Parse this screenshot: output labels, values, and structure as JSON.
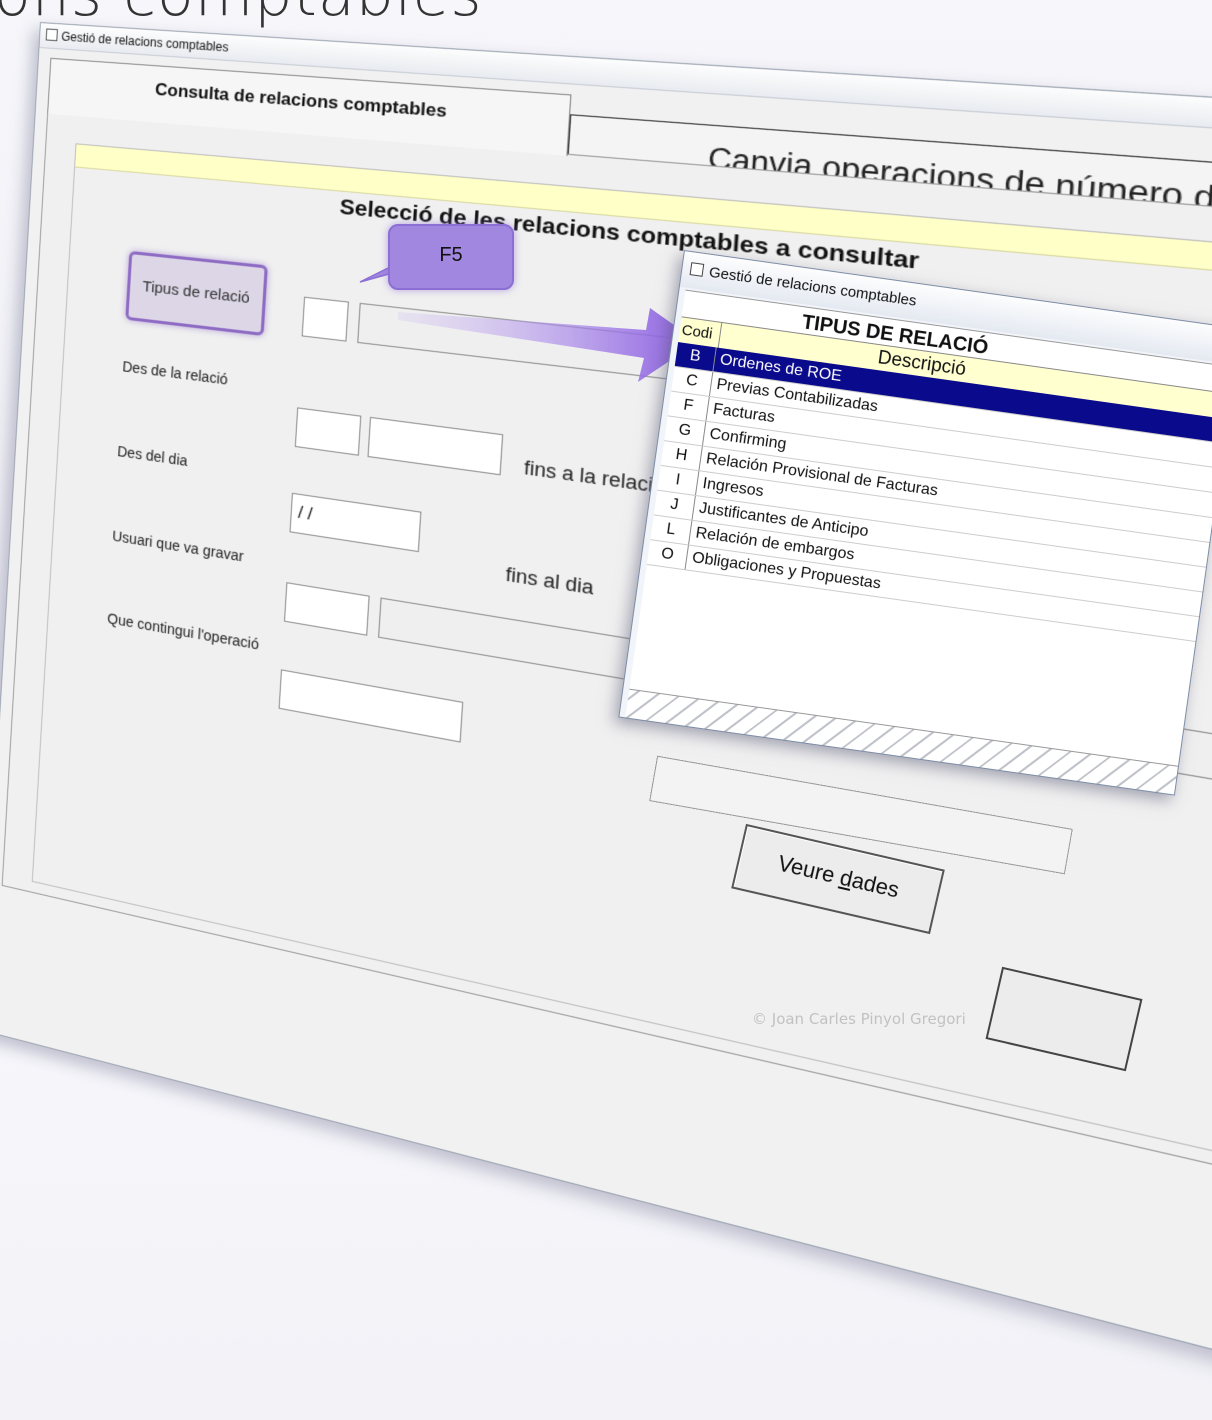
{
  "slide": {
    "title": "ons comptables"
  },
  "window": {
    "title": "Gestió de relacions comptables"
  },
  "tabs": [
    {
      "label": "Consulta de relacions comptables"
    },
    {
      "label": "Canvia operacions de número de relació"
    }
  ],
  "section": {
    "heading": "Selecció de les relacions comptables a consultar"
  },
  "form": {
    "tipus_button": "Tipus de relació",
    "des_relacio": "Des de la relació",
    "fins_relacio": "fins a la relació",
    "des_dia": "Des del dia",
    "des_dia_value": "/ /",
    "fins_dia": "fins al dia",
    "usuari": "Usuari que va gravar",
    "que_contingui": "Que contingui l'operació"
  },
  "callout": {
    "label": "F5"
  },
  "popup": {
    "title": "Gestió de relacions comptables",
    "grid_title": "TIPUS DE RELACIÓ",
    "col_codi": "Codi",
    "col_descripcio": "Descripció",
    "rows": [
      {
        "codi": "B",
        "desc": "Ordenes de ROE"
      },
      {
        "codi": "C",
        "desc": "Previas Contabilizadas"
      },
      {
        "codi": "F",
        "desc": "Facturas"
      },
      {
        "codi": "G",
        "desc": "Confirming"
      },
      {
        "codi": "H",
        "desc": "Relación Provisional de Facturas"
      },
      {
        "codi": "I",
        "desc": "Ingresos"
      },
      {
        "codi": "J",
        "desc": "Justificantes de Anticipo"
      },
      {
        "codi": "L",
        "desc": "Relación de embargos"
      },
      {
        "codi": "O",
        "desc": "Obligaciones y Propuestas"
      }
    ]
  },
  "buttons": {
    "veure_dades_pre": "Veure ",
    "veure_dades_u": "d",
    "veure_dades_post": "ades"
  },
  "watermark": "© Joan Carles Pinyol Gregori",
  "colors": {
    "accent": "#8e6cc4",
    "band": "#ffffc8",
    "selection": "#0a0a8c"
  }
}
